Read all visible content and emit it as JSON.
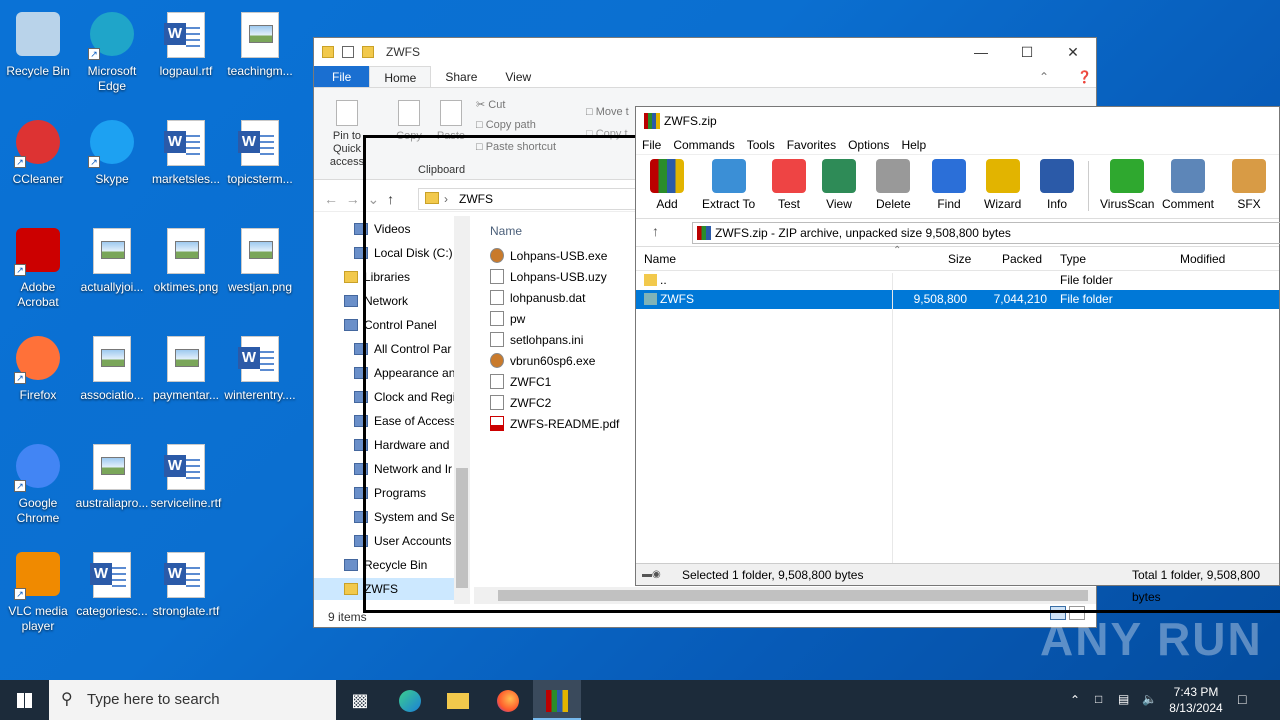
{
  "desktop": {
    "icons": [
      {
        "label": "Recycle Bin",
        "icon": "recycle-bin-icon"
      },
      {
        "label": "Microsoft Edge",
        "icon": "edge-icon"
      },
      {
        "label": "logpaul.rtf",
        "icon": "word-doc-icon"
      },
      {
        "label": "teachingm...",
        "icon": "image-file-icon"
      },
      {
        "label": "CCleaner",
        "icon": "ccleaner-icon"
      },
      {
        "label": "Skype",
        "icon": "skype-icon"
      },
      {
        "label": "marketsles...",
        "icon": "word-doc-icon"
      },
      {
        "label": "topicsterm...",
        "icon": "word-doc-icon"
      },
      {
        "label": "Adobe Acrobat",
        "icon": "acrobat-icon"
      },
      {
        "label": "actuallyjoi...",
        "icon": "image-file-icon"
      },
      {
        "label": "oktimes.png",
        "icon": "image-file-icon"
      },
      {
        "label": "westjan.png",
        "icon": "image-file-icon"
      },
      {
        "label": "Firefox",
        "icon": "firefox-icon"
      },
      {
        "label": "associatio...",
        "icon": "image-file-icon"
      },
      {
        "label": "paymentar...",
        "icon": "image-file-icon"
      },
      {
        "label": "winterentry....",
        "icon": "word-doc-icon"
      },
      {
        "label": "Google Chrome",
        "icon": "chrome-icon"
      },
      {
        "label": "australiapro...",
        "icon": "image-file-icon"
      },
      {
        "label": "serviceline.rtf",
        "icon": "word-doc-icon"
      },
      {
        "label": "VLC media player",
        "icon": "vlc-icon"
      },
      {
        "label": "categoriesc...",
        "icon": "word-doc-icon"
      },
      {
        "label": "stronglate.rtf",
        "icon": "word-doc-icon"
      }
    ]
  },
  "explorer": {
    "title": "ZWFS",
    "tabs": [
      "File",
      "Home",
      "Share",
      "View"
    ],
    "ribbon": {
      "pin": "Pin to Quick access",
      "copy": "Copy",
      "paste": "Paste",
      "cut": "Cut",
      "copy_path": "Copy path",
      "paste_shortcut": "Paste shortcut",
      "move": "Move t",
      "copy_to": "Copy t",
      "clipboard": "Clipboard"
    },
    "address": "ZWFS",
    "nav": [
      "Videos",
      "Local Disk (C:)",
      "Libraries",
      "Network",
      "Control Panel",
      "All Control Par",
      "Appearance an",
      "Clock and Regi",
      "Ease of Access",
      "Hardware and",
      "Network and Ir",
      "Programs",
      "System and Sec",
      "User Accounts",
      "Recycle Bin",
      "ZWFS"
    ],
    "column_name": "Name",
    "files": [
      "Lohpans-USB.exe",
      "Lohpans-USB.uzy",
      "lohpanusb.dat",
      "pw",
      "setlohpans.ini",
      "vbrun60sp6.exe",
      "ZWFC1",
      "ZWFC2",
      "ZWFS-README.pdf"
    ],
    "status": "9 items"
  },
  "winrar": {
    "title": "ZWFS.zip",
    "menu": [
      "File",
      "Commands",
      "Tools",
      "Favorites",
      "Options",
      "Help"
    ],
    "toolbar": [
      "Add",
      "Extract To",
      "Test",
      "View",
      "Delete",
      "Find",
      "Wizard",
      "Info",
      "VirusScan",
      "Comment",
      "SFX"
    ],
    "path": "ZWFS.zip - ZIP archive, unpacked size 9,508,800 bytes",
    "columns": [
      "Name",
      "Size",
      "Packed",
      "Type",
      "Modified"
    ],
    "rows": [
      {
        "name": "..",
        "size": "",
        "packed": "",
        "type": "File folder"
      },
      {
        "name": "ZWFS",
        "size": "9,508,800",
        "packed": "7,044,210",
        "type": "File folder"
      }
    ],
    "status_left": "Selected 1 folder, 9,508,800 bytes",
    "status_right": "Total 1 folder, 9,508,800 bytes"
  },
  "watermark": "ANY RUN",
  "taskbar": {
    "search_placeholder": "Type here to search",
    "time": "7:43 PM",
    "date": "8/13/2024"
  }
}
